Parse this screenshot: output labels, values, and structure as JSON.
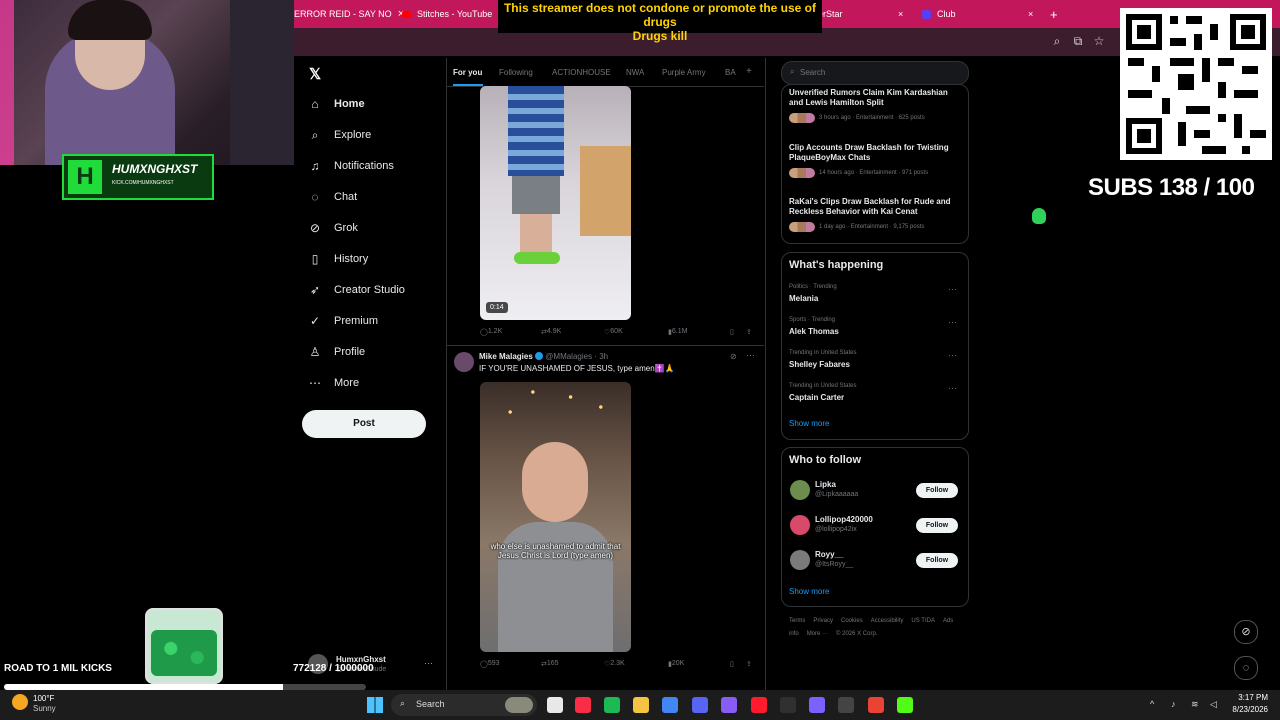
{
  "browser": {
    "tabs": [
      {
        "label": "ERROR REID - SAY NO"
      },
      {
        "label": "Stitches - YouTube"
      },
      {
        "label": "erStar"
      },
      {
        "label": "Club"
      }
    ],
    "new_tab": "+"
  },
  "banner": {
    "line1": "This streamer does not condone or promote the use of drugs",
    "line2": "Drugs kill"
  },
  "overlay": {
    "logo_mark": "H",
    "logo_name": "HUMXNGHXST",
    "logo_url": "KICK.COM/HUMXNGHXST",
    "road_label": "ROAD TO 1 MIL KICKS",
    "kicks_count": "772128 / 1000000",
    "kicks_progress": 0.77,
    "subs": "SUBS 138 / 100"
  },
  "sidebar": {
    "items": [
      {
        "label": "Home",
        "icon": "home-icon",
        "glyph": "⌂"
      },
      {
        "label": "Explore",
        "icon": "search-icon",
        "glyph": "⌕"
      },
      {
        "label": "Notifications",
        "icon": "bell-icon",
        "glyph": "♫"
      },
      {
        "label": "Chat",
        "icon": "chat-icon",
        "glyph": "◌"
      },
      {
        "label": "Grok",
        "icon": "grok-icon",
        "glyph": "⊘"
      },
      {
        "label": "History",
        "icon": "bookmark-icon",
        "glyph": "▯"
      },
      {
        "label": "Creator Studio",
        "icon": "rocket-icon",
        "glyph": "➶"
      },
      {
        "label": "Premium",
        "icon": "verified-icon",
        "glyph": "✓"
      },
      {
        "label": "Profile",
        "icon": "person-icon",
        "glyph": "♙"
      },
      {
        "label": "More",
        "icon": "more-icon",
        "glyph": "⋯"
      }
    ],
    "post_label": "Post",
    "account_name": "HumxnGhxst",
    "account_handle": "@HumxnGhude",
    "account_more": "···"
  },
  "feed": {
    "tabs": [
      "For you",
      "Following",
      "ACTIONHOUSE",
      "NWA",
      "Purple Army",
      "BA"
    ],
    "tab_add": "+",
    "tweet1": {
      "duration": "0:14",
      "replies": "1.2K",
      "reposts": "4.9K",
      "likes": "60K",
      "views": "6.1M"
    },
    "tweet2": {
      "name": "Mike Malagies",
      "handle": "@MMalagies · 3h",
      "text": "IF YOU'RE UNASHAMED OF JESUS, type amen✝️🙏",
      "caption": "who else is unashamed to admit that Jesus Christ is Lord (type amen)",
      "replies": "593",
      "reposts": "165",
      "likes": "2.3K",
      "views": "20K"
    }
  },
  "right": {
    "search_placeholder": "Search",
    "news": [
      {
        "title": "Unverified Rumors Claim Kim Kardashian and Lewis Hamilton Split",
        "meta": "3 hours ago · Entertainment · 625 posts"
      },
      {
        "title": "Clip Accounts Draw Backlash for Twisting PlaqueBoyMax Chats",
        "meta": "14 hours ago · Entertainment · 971 posts"
      },
      {
        "title": "RaKai's Clips Draw Backlash for Rude and Reckless Behavior with Kai Cenat",
        "meta": "1 day ago · Entertainment · 9,175 posts"
      }
    ],
    "happening_title": "What's happening",
    "trends": [
      {
        "meta": "Politics · Trending",
        "name": "Melania"
      },
      {
        "meta": "Sports · Trending",
        "name": "Alek Thomas"
      },
      {
        "meta": "Trending in United States",
        "name": "Shelley Fabares"
      },
      {
        "meta": "Trending in United States",
        "name": "Captain Carter"
      }
    ],
    "show_more": "Show more",
    "wtf_title": "Who to follow",
    "follow_label": "Follow",
    "wtf": [
      {
        "name": "Lipka",
        "handle": "@Lipkaaaaaa"
      },
      {
        "name": "Lollipop420000",
        "handle": "@lollipop42ix"
      },
      {
        "name": "Royy__",
        "handle": "@ItsRoyy__"
      }
    ],
    "footer": [
      "Terms",
      "Privacy",
      "Cookies",
      "Accessibility",
      "US TIDA",
      "Ads info",
      "More ···",
      "© 2026 X Corp."
    ]
  },
  "taskbar": {
    "temp": "100°F",
    "weather": "Sunny",
    "search": "Search",
    "time": "3:17 PM",
    "date": "8/23/2026"
  },
  "colors": {
    "tab_bar": "#c2185b",
    "x_blue": "#1d9bf0",
    "overlay_green": "#1fdc3a"
  }
}
